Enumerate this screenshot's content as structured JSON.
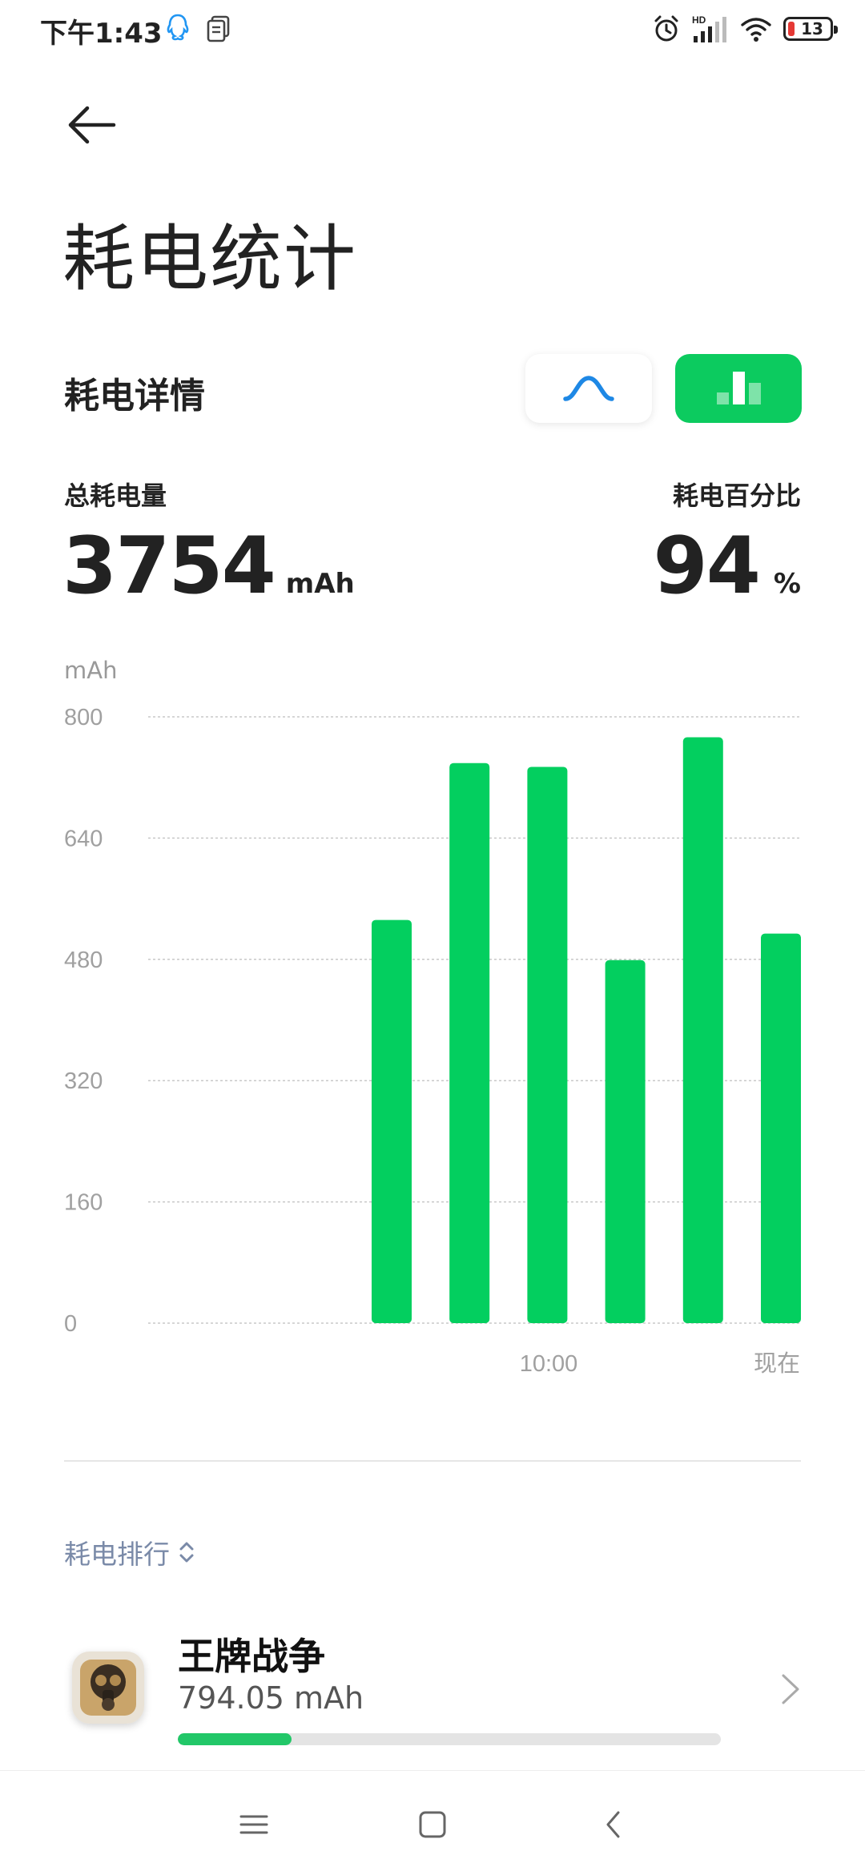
{
  "status_bar": {
    "time": "下午1:43",
    "battery_level": "13",
    "icons": [
      "qq-icon",
      "document-icon",
      "alarm-icon",
      "signal-hd-icon",
      "wifi-icon",
      "battery-icon"
    ]
  },
  "header": {
    "back_icon": "arrow-left-icon",
    "title": "耗电统计"
  },
  "details": {
    "section_title": "耗电详情",
    "view_toggle": [
      "curve-view",
      "bar-view"
    ],
    "active_view": "bar-view",
    "total_label": "总耗电量",
    "total_value": "3754",
    "total_unit": "mAh",
    "percent_label": "耗电百分比",
    "percent_value": "94",
    "percent_unit": "%"
  },
  "chart_data": {
    "type": "bar",
    "ylabel": "mAh",
    "ylim": [
      0,
      800
    ],
    "yticks": [
      "800",
      "640",
      "480",
      "320",
      "160",
      "0"
    ],
    "xtick_labels": [
      "10:00",
      "现在"
    ],
    "values": [
      532,
      739,
      734,
      479,
      773,
      514
    ],
    "bar_color": "#03cf5f",
    "grid": true
  },
  "ranking": {
    "label": "耗电排行",
    "items": [
      {
        "name": "王牌战争",
        "usage": "794.05 mAh",
        "progress": 0.21,
        "icon": "gas-mask-app-icon"
      }
    ]
  },
  "nav_bar": {
    "icons": [
      "menu-icon",
      "home-square-icon",
      "back-triangle-icon"
    ]
  }
}
